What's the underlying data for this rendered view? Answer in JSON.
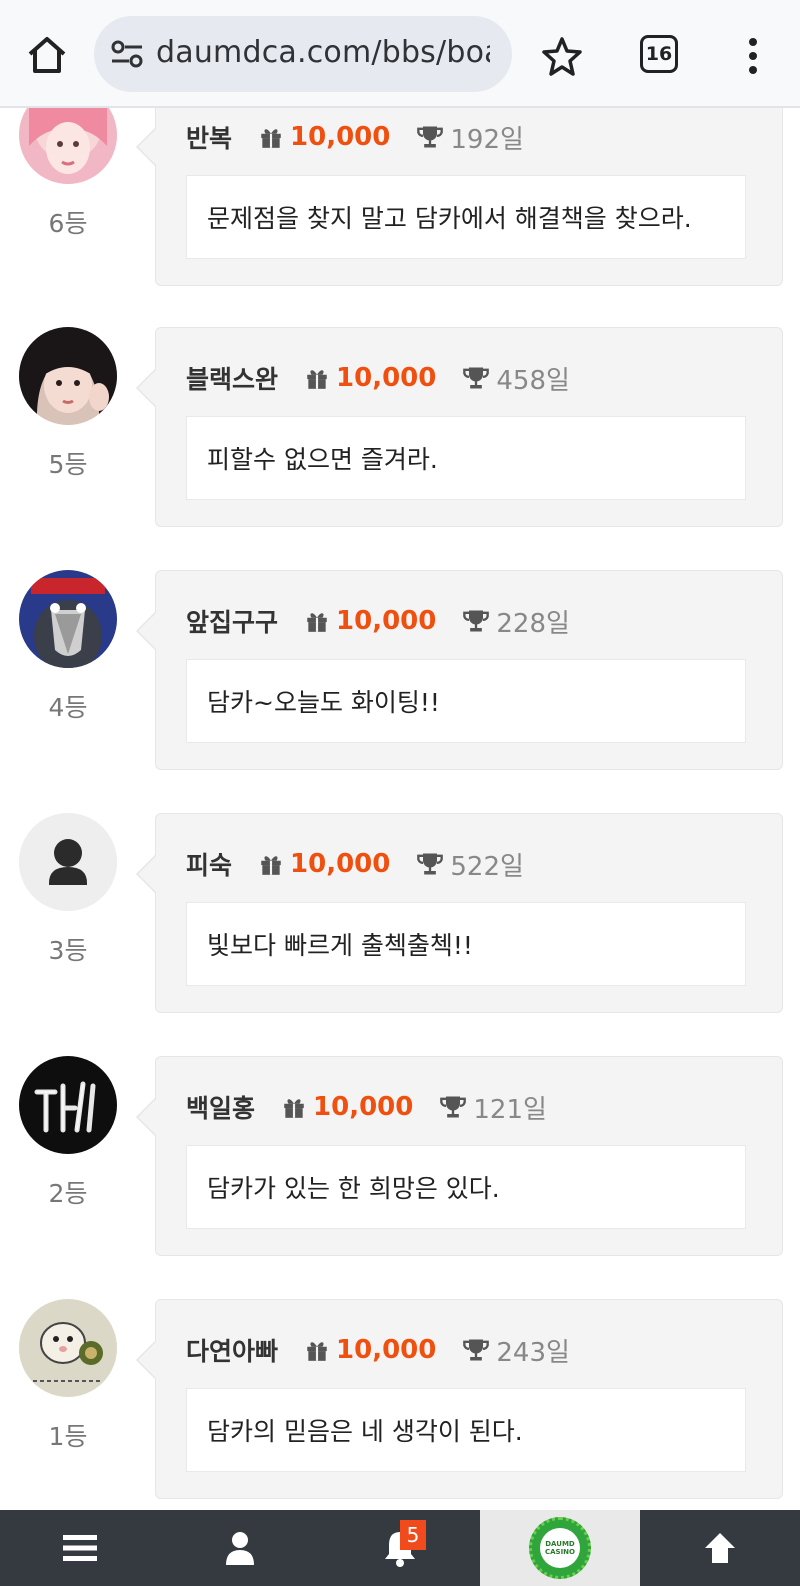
{
  "browser": {
    "url": "daumdca.com/bbs/board",
    "tab_count": "16"
  },
  "entries": [
    {
      "nick": "반복",
      "points": "10,000",
      "days": "192일",
      "rank": "6등",
      "message": "문제점을 찾지 말고 담카에서 해결책을 찾으라.",
      "avatar": "pink-haired-girl"
    },
    {
      "nick": "블랙스완",
      "points": "10,000",
      "days": "458일",
      "rank": "5등",
      "message": "피할수 없으면 즐겨라.",
      "avatar": "girl-selfie"
    },
    {
      "nick": "앞집구구",
      "points": "10,000",
      "days": "228일",
      "rank": "4등",
      "message": "담카~오늘도 화이팅!!",
      "avatar": "crying-penguin"
    },
    {
      "nick": "피숙",
      "points": "10,000",
      "days": "522일",
      "rank": "3등",
      "message": "빛보다 빠르게 출첵출첵!!",
      "avatar": "default-user"
    },
    {
      "nick": "백일홍",
      "points": "10,000",
      "days": "121일",
      "rank": "2등",
      "message": "담카가 있는 한 희망은 있다.",
      "avatar": "neon-sign"
    },
    {
      "nick": "다연아빠",
      "points": "10,000",
      "days": "243일",
      "rank": "1등",
      "message": "담카의 믿음은 네 생각이 된다.",
      "avatar": "cartoon-hamster"
    }
  ],
  "bottom_nav": {
    "notification_count": "5",
    "logo_text": "DAUMD CASINO"
  },
  "colors": {
    "points": "#ef4f0f",
    "bottom_bar": "#343a40",
    "card_bg": "#f4f4f4"
  }
}
